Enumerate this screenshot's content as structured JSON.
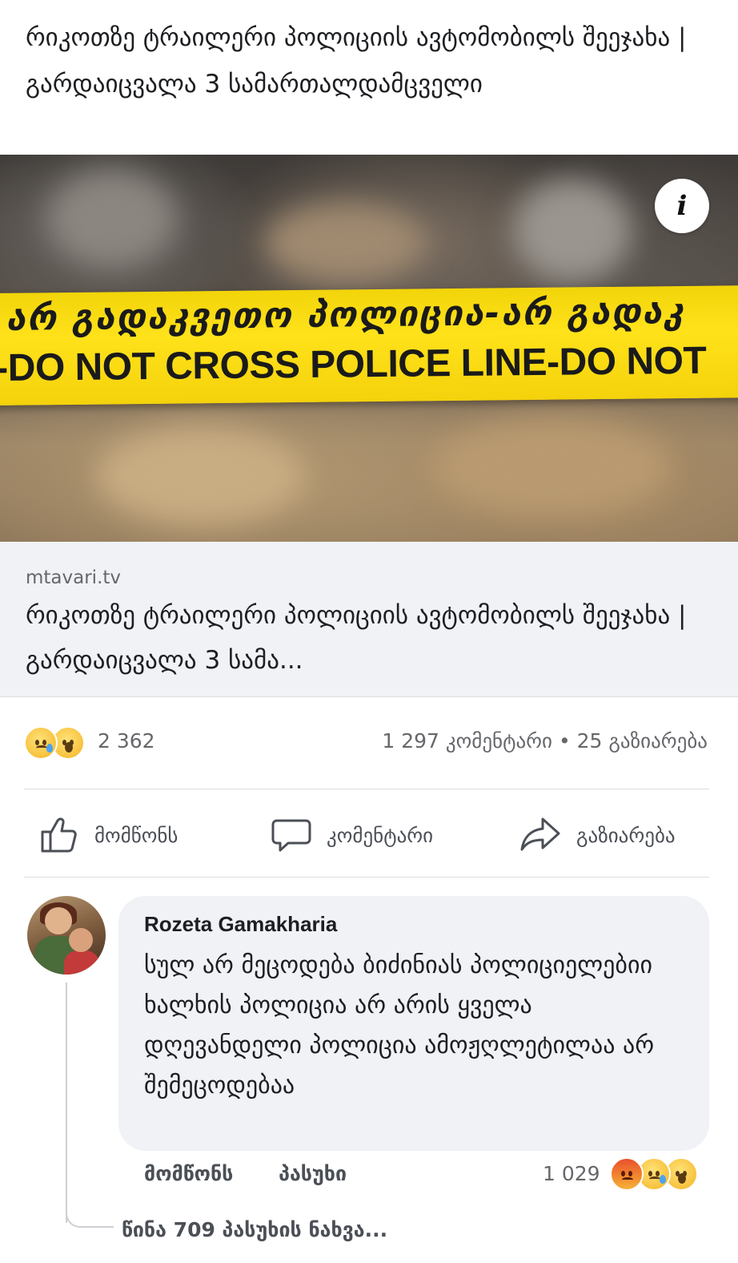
{
  "post": {
    "text": "რიკოთზე ტრაილერი პოლიციის ავტომობილს შეეჯახა | გარდაიცვალა 3 სამართალდამცველი"
  },
  "image": {
    "tape_georgian": "არ გადაკვეთო პოლიცია-არ გადაკ",
    "tape_english": "-DO NOT CROSS POLICE LINE-DO NOT",
    "info_label": "i"
  },
  "link": {
    "domain": "mtavari.tv",
    "title": "რიკოთზე ტრაილერი პოლიციის ავტომობილს შეეჯახა | გარდაიცვალა 3 სამა..."
  },
  "stats": {
    "reactions": [
      "sad-emoji",
      "wow-emoji"
    ],
    "reaction_count": "2 362",
    "comments_shares": "1 297 კომენტარი • 25 გაზიარება"
  },
  "actions": {
    "like": "მომწონს",
    "comment": "კომენტარი",
    "share": "გაზიარება"
  },
  "comment": {
    "author": "Rozeta Gamakharia",
    "text": "სულ არ მეცოდება ბიძინიას პოლიციელებიი ხალხის პოლიცია არ არის ყველა დღევანდელი პოლიცია ამოჟღლეტილაა არ შემეცოდებაა",
    "like": "მომწონს",
    "reply": "პასუხი",
    "reaction_count": "1 029",
    "reactions": [
      "angry-emoji",
      "sad-emoji",
      "wow-emoji"
    ]
  },
  "replies": {
    "label": "წინა 709 პასუხის ნახვა..."
  },
  "colors": {
    "text_primary": "#1c1e21",
    "text_secondary": "#65676b",
    "bubble_bg": "#f0f2f5",
    "tape_yellow": "#ffe21a"
  }
}
